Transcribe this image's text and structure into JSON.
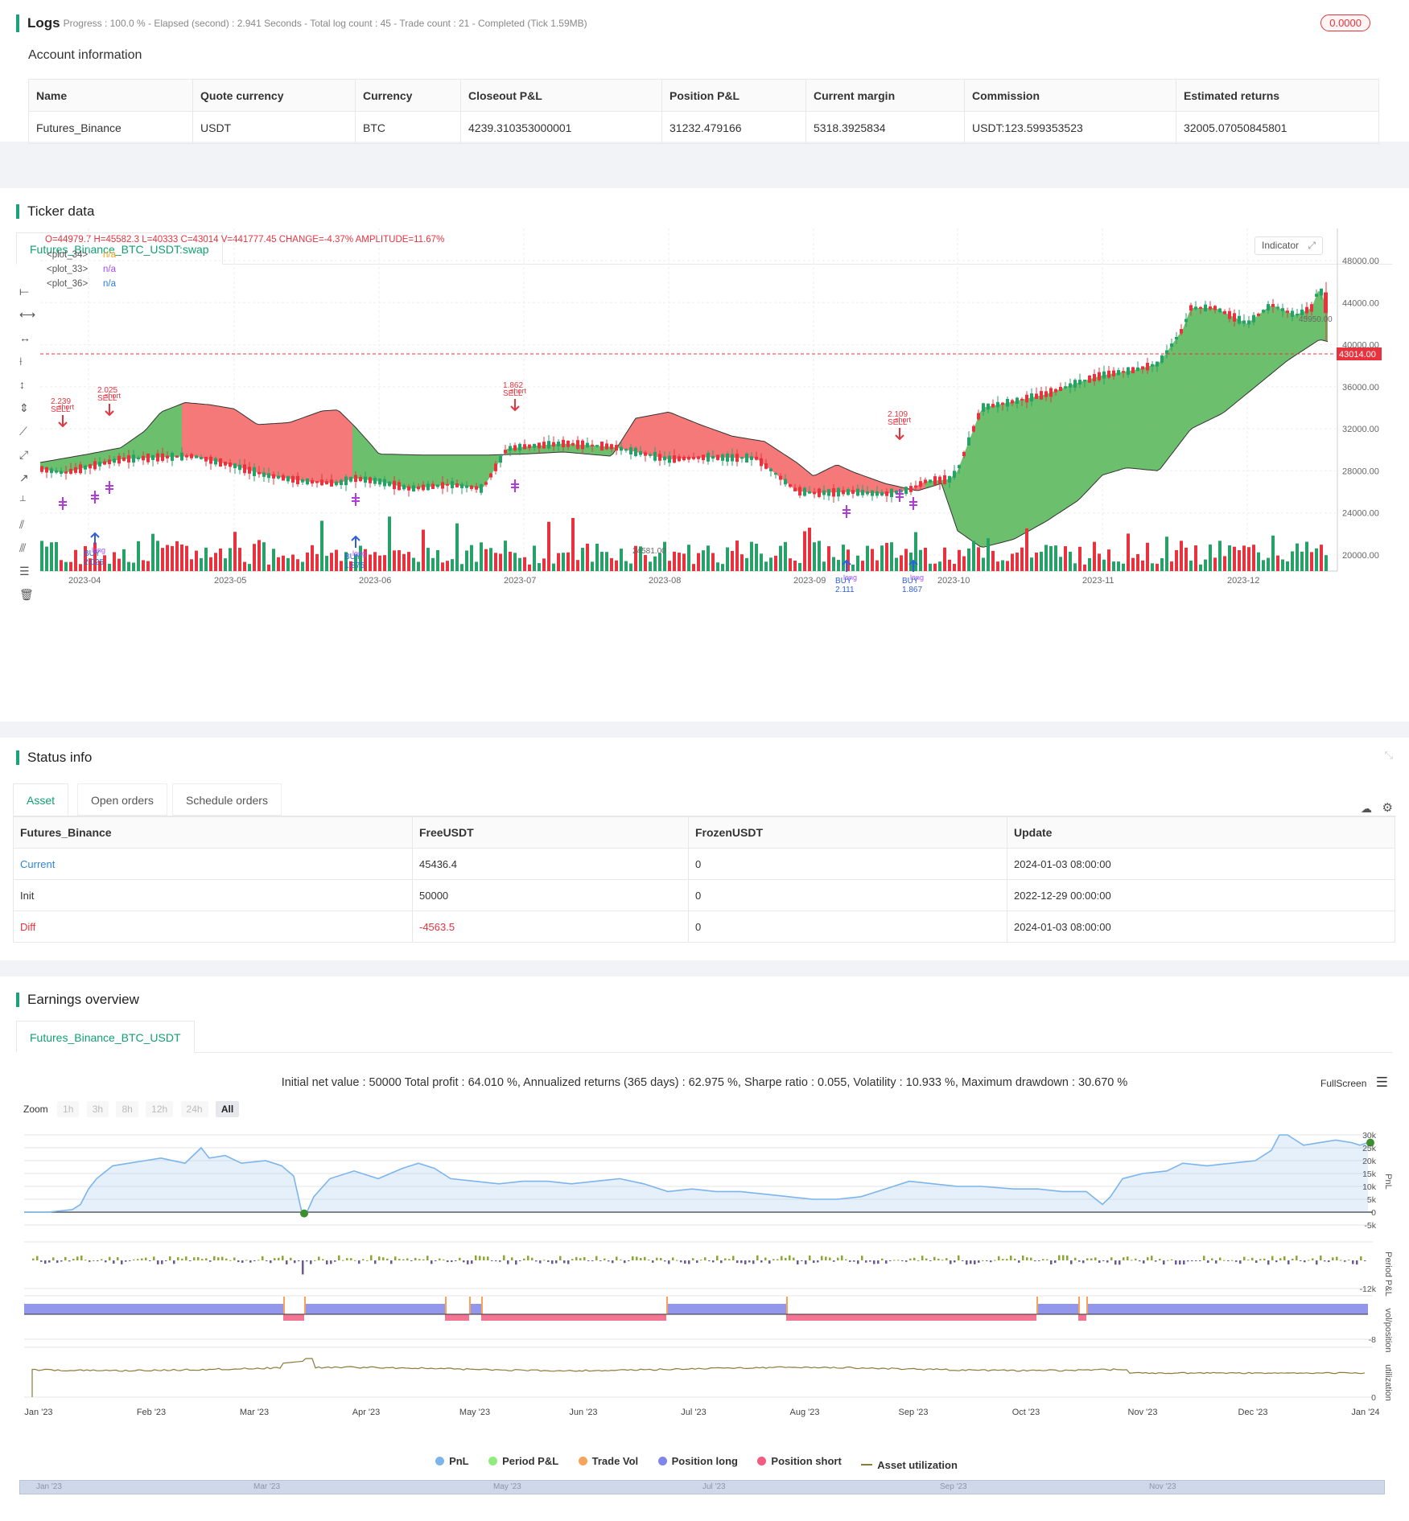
{
  "logs": {
    "title": "Logs",
    "summary": "Progress : 100.0 % - Elapsed (second) : 2.941  Seconds - Total log count : 45 - Trade count : 21 - Completed (Tick 1.59MB)",
    "badge": "0.0000"
  },
  "account": {
    "title": "Account information",
    "headers": [
      "Name",
      "Quote currency",
      "Currency",
      "Closeout P&L",
      "Position P&L",
      "Current margin",
      "Commission",
      "Estimated returns"
    ],
    "row": [
      "Futures_Binance",
      "USDT",
      "BTC",
      "4239.310353000001",
      "31232.479166",
      "5318.3925834",
      "USDT:123.599353523",
      "32005.07050845801"
    ]
  },
  "ticker": {
    "title": "Ticker data",
    "tab": "Futures_Binance_BTC_USDT:swap",
    "ohlc": {
      "O": "O=44979.7",
      "H": "H=45582.3",
      "L": "L=40333",
      "C": "C=43014",
      "V": "V=441777.45",
      "change": "CHANGE=-4.37%",
      "amp": "AMPLITUDE=11.67%"
    },
    "plots": [
      {
        "name": "<plot_34>",
        "value": "n/a",
        "color": "#f5a623"
      },
      {
        "name": "<plot_33>",
        "value": "n/a",
        "color": "#a64dff"
      },
      {
        "name": "<plot_36>",
        "value": "n/a",
        "color": "#2f7de1"
      }
    ],
    "indicator_btn": "Indicator",
    "price_labels": [
      "48000.00",
      "44000.00",
      "40000.00",
      "36000.00",
      "32000.00",
      "28000.00",
      "24000.00",
      "20000.00"
    ],
    "current_price": "43014.00",
    "high_label": "45950.00",
    "low_label": "24581.00",
    "x_labels": [
      "2023-04",
      "2023-05",
      "2023-06",
      "2023-07",
      "2023-08",
      "2023-09",
      "2023-10",
      "2023-11",
      "2023-12"
    ],
    "signals": [
      {
        "text": "2.239",
        "sub": "SELL",
        "sub2": "short",
        "color": "#e8333e",
        "dir": "down"
      },
      {
        "text": "2.025",
        "sub": "SELL",
        "sub2": "short",
        "color": "#e8333e",
        "dir": "down"
      },
      {
        "text": "1.862",
        "sub": "SELL",
        "sub2": "short",
        "color": "#e8333e",
        "dir": "down"
      },
      {
        "text": "2.109",
        "sub": "SELL",
        "sub2": "short",
        "color": "#e8333e",
        "dir": "down"
      },
      {
        "text": "2.025",
        "sub": "BUY",
        "sub2": "long",
        "color": "#2f5fe0",
        "dir": "up"
      },
      {
        "text": "1.875",
        "sub": "BUY",
        "sub2": "long",
        "color": "#2f5fe0",
        "dir": "up"
      },
      {
        "text": "2.111",
        "sub": "BUY",
        "sub2": "long",
        "color": "#2f5fe0",
        "dir": "up"
      },
      {
        "text": "1.867",
        "sub": "BUY",
        "sub2": "long",
        "color": "#2f5fe0",
        "dir": "up"
      }
    ]
  },
  "status": {
    "title": "Status info",
    "tabs": [
      "Asset",
      "Open orders",
      "Schedule orders"
    ],
    "headers": [
      "Futures_Binance",
      "FreeUSDT",
      "FrozenUSDT",
      "Update"
    ],
    "rows": [
      {
        "label": "Current",
        "free": "45436.4",
        "frozen": "0",
        "update": "2024-01-03 08:00:00",
        "color": "#2f86d6"
      },
      {
        "label": "Init",
        "free": "50000",
        "frozen": "0",
        "update": "2022-12-29 00:00:00",
        "color": "#333"
      },
      {
        "label": "Diff",
        "free": "-4563.5",
        "frozen": "0",
        "update": "2024-01-03 08:00:00",
        "color": "#e8333e"
      }
    ]
  },
  "earnings": {
    "title": "Earnings overview",
    "tab": "Futures_Binance_BTC_USDT",
    "summary": "Initial net value : 50000  Total profit : 64.010 %, Annualized returns (365 days) : 62.975 %, Sharpe ratio : 0.055, Volatility : 10.933 %, Maximum drawdown : 30.670 %",
    "fullscreen": "FullScreen",
    "zoom_label": "Zoom",
    "zoom_buttons": [
      "1h",
      "3h",
      "8h",
      "12h",
      "24h",
      "All"
    ],
    "pnl_ticks": [
      "30k",
      "25k",
      "20k",
      "15k",
      "10k",
      "5k",
      "0",
      "-5k"
    ],
    "axis_names": [
      "PnL",
      "Period P&L",
      "vol/position",
      "utilization"
    ],
    "period_tick": "-12k",
    "vol_tick": "-8",
    "util_tick": "0",
    "x_labels": [
      "Jan '23",
      "Feb '23",
      "Mar '23",
      "Apr '23",
      "May '23",
      "Jun '23",
      "Jul '23",
      "Aug '23",
      "Sep '23",
      "Oct '23",
      "Nov '23",
      "Dec '23",
      "Jan '24"
    ],
    "legend": [
      {
        "label": "PnL",
        "color": "#7cb5ec"
      },
      {
        "label": "Period P&L",
        "color": "#90ed7d"
      },
      {
        "label": "Trade Vol",
        "color": "#f7a35c"
      },
      {
        "label": "Position long",
        "color": "#8085e9"
      },
      {
        "label": "Position short",
        "color": "#f15c80"
      },
      {
        "label": "Asset utilization",
        "color": "#8d7b3a"
      }
    ],
    "navigator_labels": [
      "Jan '23",
      "Mar '23",
      "May '23",
      "Jul '23",
      "Sep '23",
      "Nov '23"
    ]
  }
}
